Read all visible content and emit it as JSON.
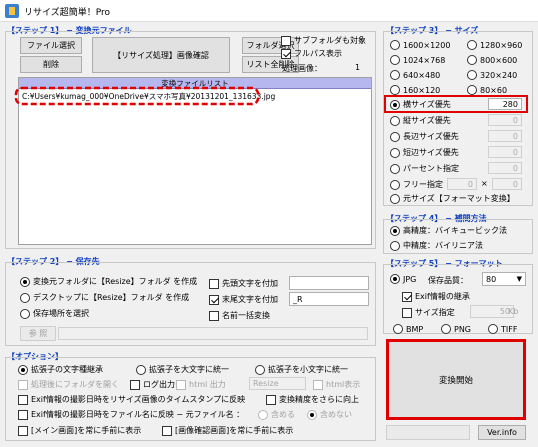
{
  "window": {
    "title": "リサイズ超簡単！Pro"
  },
  "step1": {
    "title": "【ステップ 1】 − 変換元ファイル",
    "file_select": "ファイル選択",
    "delete": "削除",
    "resize_confirm": "【リサイズ処理】画像確認",
    "folder_select": "フォルダ選択",
    "list_clear": "リスト全削除",
    "subfolder": "サブフォルダも対象",
    "fullpath": "フルパス表示",
    "processed_label": "処理画像：",
    "processed_count": "1",
    "list_header": "変換ファイルリスト",
    "files": [
      "C:¥Users¥kumag_000¥OneDrive¥スマホ写真¥20131201_131633.jpg"
    ]
  },
  "step2": {
    "title": "【ステップ 2】 − 保存先",
    "opt_same": "変換元フォルダに【Resize】フォルダ を作成",
    "opt_desktop": "デスクトップに【Resize】フォルダ を作成",
    "opt_choose": "保存場所を選択",
    "prefix": "先頭文字を付加",
    "suffix": "末尾文字を付加",
    "suffix_value": "_R",
    "rename": "名前一括変換",
    "browse": "参 照"
  },
  "options": {
    "title": "【オプション】",
    "ext_keep": "拡張子の文字種継承",
    "ext_upper": "拡張子を大文字に統一",
    "ext_lower": "拡張子を小文字に統一",
    "open_folder": "処理後にフォルダを開く",
    "log_out": "ログ出力",
    "html_out": "html 出力",
    "resize_field": "Resize",
    "html_show": "html表示",
    "exif_stamp": "Exif情報の撮影日時をリサイズ画像のタイムスタンプに反映",
    "precision": "変換精度をさらに向上",
    "exif_name": "Exif情報の撮影日時をファイル名に反映 − 元ファイル名 ：",
    "include": "含める",
    "exclude": "含めない",
    "main_front": "[メイン画面]を常に手前に表示",
    "confirm_front": "[画像確認画面]を常に手前に表示"
  },
  "step3": {
    "title": "【ステップ 3】 − サイズ",
    "presets": [
      "1600×1200",
      "1280×960",
      "1024×768",
      "800×600",
      "640×480",
      "320×240",
      "160×120",
      "80×60"
    ],
    "width": "横サイズ優先",
    "width_value": "280",
    "height": "縦サイズ優先",
    "height_value": "0",
    "long": "長辺サイズ優先",
    "long_value": "0",
    "short": "短辺サイズ優先",
    "short_value": "0",
    "percent": "パーセント指定",
    "percent_value": "0",
    "free": "フリー指定",
    "free_w": "0",
    "free_x": "×",
    "free_h": "0",
    "original": "元サイズ【フォーマット変換】"
  },
  "step4": {
    "title": "【ステップ 4】 − 補間方法",
    "bicubic": "高精度：バイキュービック法",
    "bilinear": "中精度：バイリニア法"
  },
  "step5": {
    "title": "【ステップ 5】 − フォーマット",
    "jpg": "JPG",
    "quality_label": "保存品質：",
    "quality_value": "80",
    "exif_keep": "Exif情報の継承",
    "size_limit": "サイズ指定",
    "size_value": "50",
    "size_unit": "Kb",
    "bmp": "BMP",
    "png": "PNG",
    "tiff": "TIFF"
  },
  "actions": {
    "convert": "変換開始",
    "version": "Ver.info"
  },
  "colors": {
    "accent": "#1040c0",
    "highlight": "#e00000",
    "list_header": "#b7b7f0"
  }
}
